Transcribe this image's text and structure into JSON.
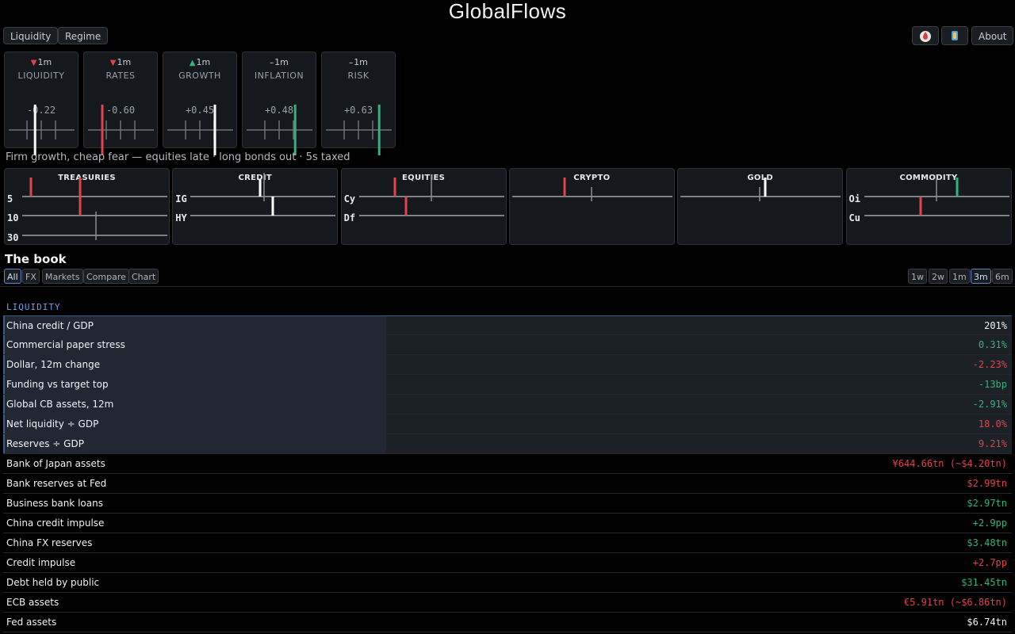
{
  "app": {
    "title": "GlobalFlows"
  },
  "nav": {
    "left": [
      "Liquidity",
      "Regime"
    ],
    "about": "About",
    "icons": [
      "droplet-icon",
      "gauge-icon"
    ]
  },
  "regime_cards": [
    {
      "name": "LIQUIDITY",
      "trend": "down",
      "arrow": "▼",
      "period": "1m",
      "value": "-0.22",
      "score": -0.22
    },
    {
      "name": "RATES",
      "trend": "down",
      "arrow": "▼",
      "period": "1m",
      "value": "-0.60",
      "score": -0.6
    },
    {
      "name": "GROWTH",
      "trend": "up",
      "arrow": "▲",
      "period": "1m",
      "value": "+0.45",
      "score": 0.45
    },
    {
      "name": "INFLATION",
      "trend": "flat",
      "arrow": "–",
      "period": "1m",
      "value": "+0.48",
      "score": 0.48
    },
    {
      "name": "RISK",
      "trend": "flat",
      "arrow": "–",
      "period": "1m",
      "value": "+0.63",
      "score": 0.63
    }
  ],
  "regime_summary": "Firm growth, cheap fear — equities late · long bonds out · 5s taxed",
  "markets": [
    {
      "title": "TREASURIES",
      "rows": [
        "5",
        "10",
        "30"
      ]
    },
    {
      "title": "CREDIT",
      "rows": [
        "IG",
        "HY"
      ]
    },
    {
      "title": "EQUITIES",
      "rows": [
        "Cy",
        "Df"
      ]
    },
    {
      "title": "CRYPTO",
      "rows": [
        ""
      ]
    },
    {
      "title": "GOLD",
      "rows": [
        ""
      ]
    },
    {
      "title": "COMMODITY",
      "rows": [
        "Oi",
        "Cu"
      ]
    }
  ],
  "book": {
    "title": "The book",
    "filters": [
      "All",
      "FX",
      "Markets",
      "Compare",
      "Chart"
    ],
    "active_filter": "All",
    "periods": [
      "1w",
      "2w",
      "1m",
      "3m",
      "6m"
    ],
    "active_period": "3m",
    "group": "LIQUIDITY",
    "rows": [
      {
        "label": "China credit / GDP",
        "value": "201%",
        "tone": "neu",
        "highlight": true
      },
      {
        "label": "Commercial paper stress",
        "value": "0.31%",
        "tone": "pos",
        "highlight": true
      },
      {
        "label": "Dollar, 12m change",
        "value": "-2.23%",
        "tone": "neg",
        "highlight": true
      },
      {
        "label": "Funding vs target top",
        "value": "-13bp",
        "tone": "pos",
        "highlight": true
      },
      {
        "label": "Global CB assets, 12m",
        "value": "-2.91%",
        "tone": "pos",
        "highlight": true
      },
      {
        "label": "Net liquidity ÷ GDP",
        "value": "18.0%",
        "tone": "neg",
        "highlight": true
      },
      {
        "label": "Reserves ÷ GDP",
        "value": "9.21%",
        "tone": "neg",
        "highlight": true
      },
      {
        "label": "Bank of Japan assets",
        "value": "¥644.66tn (~$4.20tn)",
        "tone": "neg",
        "highlight": false
      },
      {
        "label": "Bank reserves at Fed",
        "value": "$2.99tn",
        "tone": "neg",
        "highlight": false
      },
      {
        "label": "Business bank loans",
        "value": "$2.97tn",
        "tone": "pos",
        "highlight": false
      },
      {
        "label": "China credit impulse",
        "value": "+2.9pp",
        "tone": "pos",
        "highlight": false
      },
      {
        "label": "China FX reserves",
        "value": "$3.48tn",
        "tone": "pos",
        "highlight": false
      },
      {
        "label": "Credit impulse",
        "value": "+2.7pp",
        "tone": "neg",
        "highlight": false
      },
      {
        "label": "Debt held by public",
        "value": "$31.45tn",
        "tone": "pos",
        "highlight": false
      },
      {
        "label": "ECB assets",
        "value": "€5.91tn (~$6.86tn)",
        "tone": "neg",
        "highlight": false
      },
      {
        "label": "Fed assets",
        "value": "$6.74tn",
        "tone": "neu",
        "highlight": false
      }
    ]
  },
  "colors": {
    "positive": "#2fb47a",
    "negative": "#e0434c",
    "accent": "#6ea0e6",
    "background": "#000000"
  }
}
